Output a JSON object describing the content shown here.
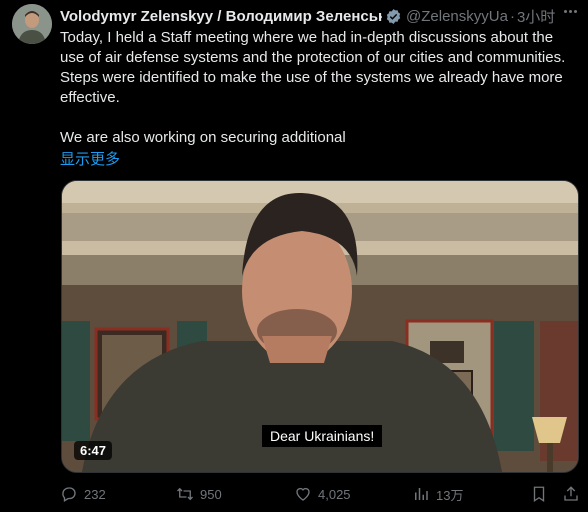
{
  "tweet": {
    "author_name": "Volodymyr Zelenskyy / Володимир Зеленський",
    "handle": "@ZelenskyyUa",
    "separator": "·",
    "time": "3小时",
    "paragraph1": "Today, I held a Staff meeting where we had in-depth discussions about the use of air defense systems and the protection of our cities and communities. Steps were identified to make the use of the systems we already have more effective.",
    "paragraph2": "We are also working on securing additional",
    "show_more": "显示更多"
  },
  "video": {
    "duration": "6:47",
    "subtitle": "Dear Ukrainians!"
  },
  "actions": {
    "replies": "232",
    "reposts": "950",
    "likes": "4,025",
    "views": "13万"
  },
  "icons": {
    "verified": "verified-badge-icon",
    "more": "more-icon",
    "reply": "reply-icon",
    "repost": "repost-icon",
    "like": "heart-icon",
    "views": "views-icon",
    "bookmark": "bookmark-icon",
    "share": "share-icon"
  },
  "colors": {
    "background": "#000000",
    "text": "#e7e9ea",
    "muted": "#71767b",
    "link": "#1d9bf0",
    "verified": "#829aab"
  }
}
